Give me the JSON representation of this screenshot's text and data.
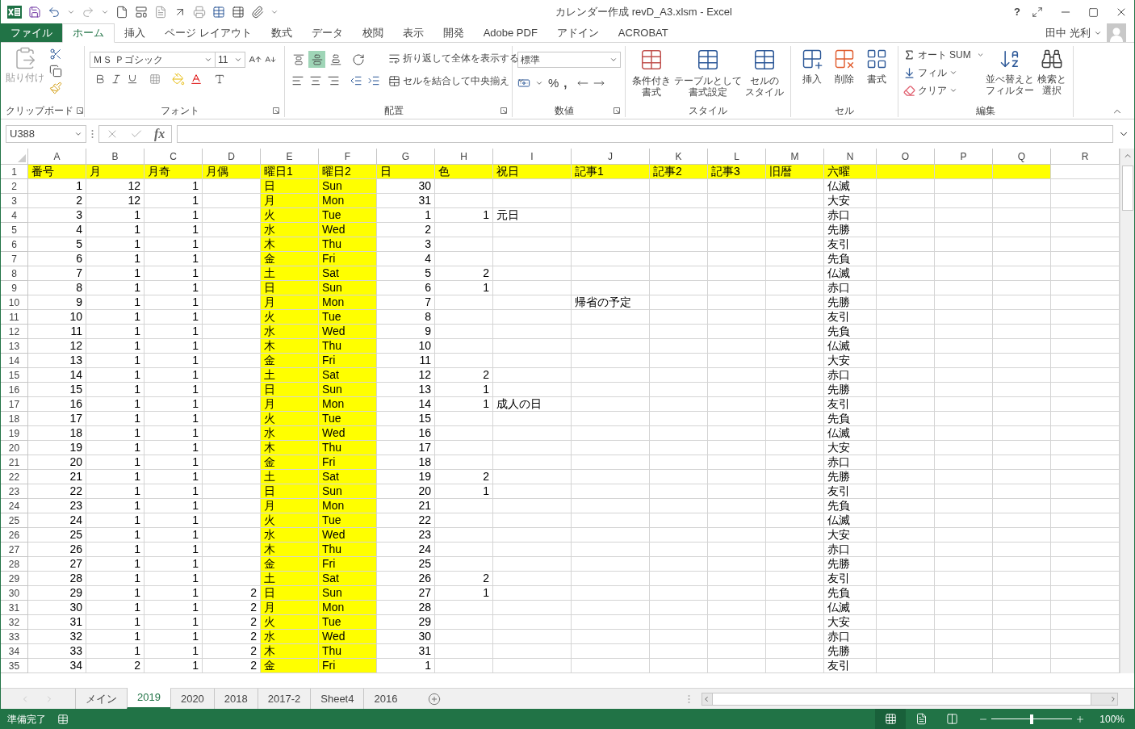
{
  "window": {
    "title": "カレンダー作成 revD_A3.xlsm - Excel",
    "help": "?",
    "user": "田中 光利"
  },
  "ribbon_tabs": [
    {
      "label": "ファイル",
      "kind": "file",
      "selected": false
    },
    {
      "label": "ホーム",
      "kind": "tab",
      "selected": true
    },
    {
      "label": "挿入",
      "kind": "tab",
      "selected": false
    },
    {
      "label": "ページ レイアウト",
      "kind": "tab",
      "selected": false
    },
    {
      "label": "数式",
      "kind": "tab",
      "selected": false
    },
    {
      "label": "データ",
      "kind": "tab",
      "selected": false
    },
    {
      "label": "校閲",
      "kind": "tab",
      "selected": false
    },
    {
      "label": "表示",
      "kind": "tab",
      "selected": false
    },
    {
      "label": "開発",
      "kind": "tab",
      "selected": false
    },
    {
      "label": "Adobe PDF",
      "kind": "tab",
      "selected": false
    },
    {
      "label": "アドイン",
      "kind": "tab",
      "selected": false
    },
    {
      "label": "ACROBAT",
      "kind": "tab",
      "selected": false
    }
  ],
  "ribbon": {
    "clipboard": {
      "label": "クリップボード",
      "paste": "貼り付け"
    },
    "font": {
      "label": "フォント",
      "name": "ＭＳ Ｐゴシック",
      "size": "11"
    },
    "alignment": {
      "label": "配置",
      "wrap": "折り返して全体を表示する",
      "merge": "セルを結合して中央揃え",
      "vertical": [
        {
          "selected": false
        },
        {
          "selected": true
        },
        {
          "selected": false
        }
      ]
    },
    "number": {
      "label": "数値",
      "format": "標準",
      "percent": "%",
      "comma": ","
    },
    "styles": {
      "label": "スタイル",
      "buttons": [
        {
          "lines": [
            "条件付き",
            "書式"
          ]
        },
        {
          "lines": [
            "テーブルとして",
            "書式設定"
          ]
        },
        {
          "lines": [
            "セルの",
            "スタイル"
          ]
        }
      ]
    },
    "cells": {
      "label": "セル",
      "buttons": [
        "挿入",
        "削除",
        "書式"
      ]
    },
    "editing": {
      "label": "編集",
      "autosum": "オート SUM",
      "fill": "フィル",
      "clear": "クリア",
      "sort": [
        "並べ替えと",
        "フィルター"
      ],
      "find": [
        "検索と",
        "選択"
      ]
    }
  },
  "formula_bar": {
    "name_box": "U388",
    "function_label": "fx"
  },
  "sheet": {
    "columns": [
      {
        "letter": "A",
        "kind": "number",
        "highlight": false,
        "header_highlight": true
      },
      {
        "letter": "B",
        "kind": "number",
        "highlight": false,
        "header_highlight": true
      },
      {
        "letter": "C",
        "kind": "number",
        "highlight": false,
        "header_highlight": true
      },
      {
        "letter": "D",
        "kind": "number",
        "highlight": false,
        "header_highlight": true
      },
      {
        "letter": "E",
        "kind": "text",
        "highlight": true,
        "header_highlight": true
      },
      {
        "letter": "F",
        "kind": "text",
        "highlight": true,
        "header_highlight": true
      },
      {
        "letter": "G",
        "kind": "number",
        "highlight": false,
        "header_highlight": true
      },
      {
        "letter": "H",
        "kind": "number",
        "highlight": false,
        "header_highlight": true
      },
      {
        "letter": "I",
        "kind": "text",
        "highlight": false,
        "header_highlight": true
      },
      {
        "letter": "J",
        "kind": "text",
        "highlight": false,
        "header_highlight": true
      },
      {
        "letter": "K",
        "kind": "text",
        "highlight": false,
        "header_highlight": true
      },
      {
        "letter": "L",
        "kind": "text",
        "highlight": false,
        "header_highlight": true
      },
      {
        "letter": "M",
        "kind": "text",
        "highlight": false,
        "header_highlight": true
      },
      {
        "letter": "N",
        "kind": "text",
        "highlight": false,
        "header_highlight": true
      },
      {
        "letter": "O",
        "kind": "text",
        "highlight": false,
        "header_highlight": true
      },
      {
        "letter": "P",
        "kind": "text",
        "highlight": false,
        "header_highlight": true
      },
      {
        "letter": "Q",
        "kind": "text",
        "highlight": false,
        "header_highlight": true
      },
      {
        "letter": "R",
        "kind": "text",
        "highlight": false,
        "header_highlight": false
      }
    ],
    "header_row": {
      "num": "1",
      "cells": [
        "番号",
        "月",
        "月奇",
        "月偶",
        "曜日1",
        "曜日2",
        "日",
        "色",
        "祝日",
        "記事1",
        "記事2",
        "記事3",
        "旧暦",
        "六曜"
      ]
    },
    "rows": [
      {
        "num": "2",
        "cells": [
          "1",
          "12",
          "1",
          null,
          "日",
          "Sun",
          "30",
          null,
          null,
          null,
          null,
          null,
          null,
          "仏滅"
        ]
      },
      {
        "num": "3",
        "cells": [
          "2",
          "12",
          "1",
          null,
          "月",
          "Mon",
          "31",
          null,
          null,
          null,
          null,
          null,
          null,
          "大安"
        ]
      },
      {
        "num": "4",
        "cells": [
          "3",
          "1",
          "1",
          null,
          "火",
          "Tue",
          "1",
          "1",
          "元日",
          null,
          null,
          null,
          null,
          "赤口"
        ]
      },
      {
        "num": "5",
        "cells": [
          "4",
          "1",
          "1",
          null,
          "水",
          "Wed",
          "2",
          null,
          null,
          null,
          null,
          null,
          null,
          "先勝"
        ]
      },
      {
        "num": "6",
        "cells": [
          "5",
          "1",
          "1",
          null,
          "木",
          "Thu",
          "3",
          null,
          null,
          null,
          null,
          null,
          null,
          "友引"
        ]
      },
      {
        "num": "7",
        "cells": [
          "6",
          "1",
          "1",
          null,
          "金",
          "Fri",
          "4",
          null,
          null,
          null,
          null,
          null,
          null,
          "先負"
        ]
      },
      {
        "num": "8",
        "cells": [
          "7",
          "1",
          "1",
          null,
          "土",
          "Sat",
          "5",
          "2",
          null,
          null,
          null,
          null,
          null,
          "仏滅"
        ]
      },
      {
        "num": "9",
        "cells": [
          "8",
          "1",
          "1",
          null,
          "日",
          "Sun",
          "6",
          "1",
          null,
          null,
          null,
          null,
          null,
          "赤口"
        ]
      },
      {
        "num": "10",
        "cells": [
          "9",
          "1",
          "1",
          null,
          "月",
          "Mon",
          "7",
          null,
          null,
          "帰省の予定",
          null,
          null,
          null,
          "先勝"
        ]
      },
      {
        "num": "11",
        "cells": [
          "10",
          "1",
          "1",
          null,
          "火",
          "Tue",
          "8",
          null,
          null,
          null,
          null,
          null,
          null,
          "友引"
        ]
      },
      {
        "num": "12",
        "cells": [
          "11",
          "1",
          "1",
          null,
          "水",
          "Wed",
          "9",
          null,
          null,
          null,
          null,
          null,
          null,
          "先負"
        ]
      },
      {
        "num": "13",
        "cells": [
          "12",
          "1",
          "1",
          null,
          "木",
          "Thu",
          "10",
          null,
          null,
          null,
          null,
          null,
          null,
          "仏滅"
        ]
      },
      {
        "num": "14",
        "cells": [
          "13",
          "1",
          "1",
          null,
          "金",
          "Fri",
          "11",
          null,
          null,
          null,
          null,
          null,
          null,
          "大安"
        ]
      },
      {
        "num": "15",
        "cells": [
          "14",
          "1",
          "1",
          null,
          "土",
          "Sat",
          "12",
          "2",
          null,
          null,
          null,
          null,
          null,
          "赤口"
        ]
      },
      {
        "num": "16",
        "cells": [
          "15",
          "1",
          "1",
          null,
          "日",
          "Sun",
          "13",
          "1",
          null,
          null,
          null,
          null,
          null,
          "先勝"
        ]
      },
      {
        "num": "17",
        "cells": [
          "16",
          "1",
          "1",
          null,
          "月",
          "Mon",
          "14",
          "1",
          "成人の日",
          null,
          null,
          null,
          null,
          "友引"
        ]
      },
      {
        "num": "18",
        "cells": [
          "17",
          "1",
          "1",
          null,
          "火",
          "Tue",
          "15",
          null,
          null,
          null,
          null,
          null,
          null,
          "先負"
        ]
      },
      {
        "num": "19",
        "cells": [
          "18",
          "1",
          "1",
          null,
          "水",
          "Wed",
          "16",
          null,
          null,
          null,
          null,
          null,
          null,
          "仏滅"
        ]
      },
      {
        "num": "20",
        "cells": [
          "19",
          "1",
          "1",
          null,
          "木",
          "Thu",
          "17",
          null,
          null,
          null,
          null,
          null,
          null,
          "大安"
        ]
      },
      {
        "num": "21",
        "cells": [
          "20",
          "1",
          "1",
          null,
          "金",
          "Fri",
          "18",
          null,
          null,
          null,
          null,
          null,
          null,
          "赤口"
        ]
      },
      {
        "num": "22",
        "cells": [
          "21",
          "1",
          "1",
          null,
          "土",
          "Sat",
          "19",
          "2",
          null,
          null,
          null,
          null,
          null,
          "先勝"
        ]
      },
      {
        "num": "23",
        "cells": [
          "22",
          "1",
          "1",
          null,
          "日",
          "Sun",
          "20",
          "1",
          null,
          null,
          null,
          null,
          null,
          "友引"
        ]
      },
      {
        "num": "24",
        "cells": [
          "23",
          "1",
          "1",
          null,
          "月",
          "Mon",
          "21",
          null,
          null,
          null,
          null,
          null,
          null,
          "先負"
        ]
      },
      {
        "num": "25",
        "cells": [
          "24",
          "1",
          "1",
          null,
          "火",
          "Tue",
          "22",
          null,
          null,
          null,
          null,
          null,
          null,
          "仏滅"
        ]
      },
      {
        "num": "26",
        "cells": [
          "25",
          "1",
          "1",
          null,
          "水",
          "Wed",
          "23",
          null,
          null,
          null,
          null,
          null,
          null,
          "大安"
        ]
      },
      {
        "num": "27",
        "cells": [
          "26",
          "1",
          "1",
          null,
          "木",
          "Thu",
          "24",
          null,
          null,
          null,
          null,
          null,
          null,
          "赤口"
        ]
      },
      {
        "num": "28",
        "cells": [
          "27",
          "1",
          "1",
          null,
          "金",
          "Fri",
          "25",
          null,
          null,
          null,
          null,
          null,
          null,
          "先勝"
        ]
      },
      {
        "num": "29",
        "cells": [
          "28",
          "1",
          "1",
          null,
          "土",
          "Sat",
          "26",
          "2",
          null,
          null,
          null,
          null,
          null,
          "友引"
        ]
      },
      {
        "num": "30",
        "cells": [
          "29",
          "1",
          "1",
          "2",
          "日",
          "Sun",
          "27",
          "1",
          null,
          null,
          null,
          null,
          null,
          "先負"
        ]
      },
      {
        "num": "31",
        "cells": [
          "30",
          "1",
          "1",
          "2",
          "月",
          "Mon",
          "28",
          null,
          null,
          null,
          null,
          null,
          null,
          "仏滅"
        ]
      },
      {
        "num": "32",
        "cells": [
          "31",
          "1",
          "1",
          "2",
          "火",
          "Tue",
          "29",
          null,
          null,
          null,
          null,
          null,
          null,
          "大安"
        ]
      },
      {
        "num": "33",
        "cells": [
          "32",
          "1",
          "1",
          "2",
          "水",
          "Wed",
          "30",
          null,
          null,
          null,
          null,
          null,
          null,
          "赤口"
        ]
      },
      {
        "num": "34",
        "cells": [
          "33",
          "1",
          "1",
          "2",
          "木",
          "Thu",
          "31",
          null,
          null,
          null,
          null,
          null,
          null,
          "先勝"
        ]
      },
      {
        "num": "35",
        "cells": [
          "34",
          "2",
          "1",
          "2",
          "金",
          "Fri",
          "1",
          null,
          null,
          null,
          null,
          null,
          null,
          "友引"
        ]
      }
    ]
  },
  "sheet_tabs": [
    {
      "label": "メイン",
      "selected": false
    },
    {
      "label": "2019",
      "selected": true
    },
    {
      "label": "2020",
      "selected": false
    },
    {
      "label": "2018",
      "selected": false
    },
    {
      "label": "2017-2",
      "selected": false
    },
    {
      "label": "Sheet4",
      "selected": false
    },
    {
      "label": "2016",
      "selected": false
    }
  ],
  "status_bar": {
    "text": "準備完了",
    "views": [
      {
        "kind": "normal",
        "selected": true
      },
      {
        "kind": "page_layout",
        "selected": false
      },
      {
        "kind": "page_break",
        "selected": false
      }
    ],
    "zoom": {
      "level": 0.5,
      "reading": "100%"
    }
  }
}
